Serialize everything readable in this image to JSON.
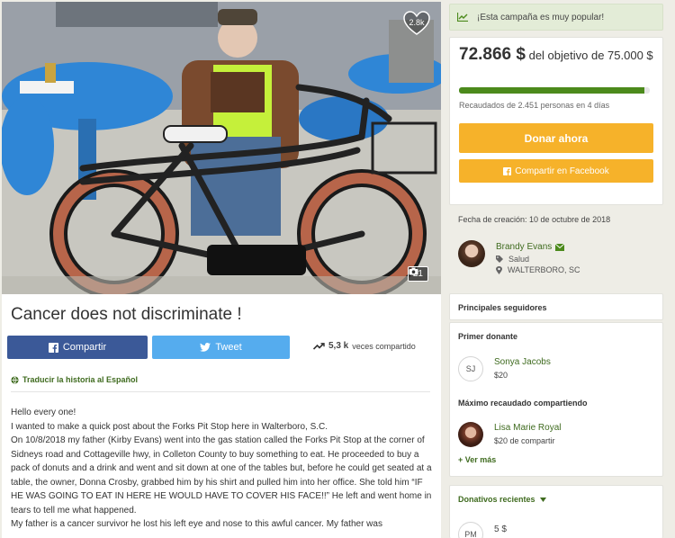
{
  "hero": {
    "likes_count": "2.8k",
    "photo_count": "21"
  },
  "campaign": {
    "title": "Cancer does not discriminate !",
    "share_facebook_label": "Compartir",
    "tweet_label": "Tweet",
    "shares_count": "5,3 k",
    "shares_suffix": "veces compartido",
    "translate_label": "Traducir la historia al Español",
    "story": [
      "Hello every one!",
      "I wanted to make a quick post about the Forks Pit Stop here in Walterboro, S.C.",
      "On 10/8/2018 my father (Kirby Evans) went into the gas station called the Forks Pit Stop at the corner of Sidneys road and Cottageville hwy, in Colleton County to buy something to eat. He proceeded to buy a pack of donuts and a drink and went and sit down at one of the tables but, before he could get seated at a table, the owner, Donna Crosby, grabbed him by his shirt and pulled him into her office. She told him “IF HE WAS GOING TO EAT IN HERE HE WOULD HAVE TO COVER HIS FACE!!” He left and went home in tears to tell me what happened.",
      "My father is a cancer survivor he lost his left eye and nose to this awful cancer. My father was"
    ]
  },
  "sidebar": {
    "popular_alert": "¡Esta campaña es muy popular!",
    "amount_raised": "72.866 $",
    "goal_text": "del objetivo de 75.000 $",
    "progress_fraction": 0.9715,
    "raised_by": "Recaudados de 2.451 personas en 4 días",
    "donate_label": "Donar ahora",
    "share_fb_label": "Compartir en Facebook",
    "created": "Fecha de creación: 10 de octubre de 2018",
    "organizer": {
      "name": "Brandy Evans",
      "category": "Salud",
      "location": "WALTERBORO, SC"
    },
    "top_supporters_title": "Principales seguidores",
    "first_donor_title": "Primer donante",
    "first_donor": {
      "initials": "SJ",
      "name": "Sonya Jacobs",
      "amount": "$20"
    },
    "top_sharer_title": "Máximo recaudado compartiendo",
    "top_sharer": {
      "name": "Lisa Marie Royal",
      "amount": "$20 de compartir"
    },
    "see_more": "+ Ver más",
    "recent_donations_title": "Donativos recientes",
    "recent_donation": {
      "initials": "PM",
      "amount": "5 $"
    }
  },
  "colors": {
    "brand_green": "#4c8a1c",
    "donate_orange": "#f6b22a",
    "facebook_blue": "#3b5998",
    "twitter_blue": "#55acee"
  }
}
